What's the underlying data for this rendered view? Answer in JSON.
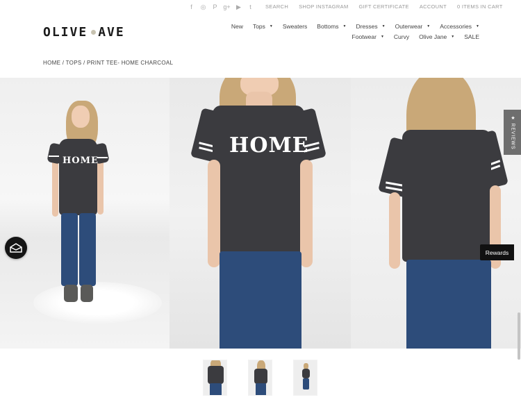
{
  "topbar": {
    "social_icons": [
      "facebook-icon",
      "instagram-icon",
      "pinterest-icon",
      "google-plus-icon",
      "youtube-icon",
      "twitter-icon"
    ],
    "social_glyphs": [
      "f",
      "◎",
      "P",
      "g+",
      "▶",
      "t"
    ],
    "links": [
      "SEARCH",
      "SHOP INSTAGRAM",
      "GIFT CERTIFICATE",
      "ACCOUNT",
      "0 ITEMS IN CART"
    ]
  },
  "logo": {
    "left": "OLIVE",
    "right": "AVE",
    "dot_color": "#c7c2b0"
  },
  "nav": {
    "row1": [
      {
        "label": "New",
        "dropdown": false
      },
      {
        "label": "Tops",
        "dropdown": true
      },
      {
        "label": "Sweaters",
        "dropdown": false
      },
      {
        "label": "Bottoms",
        "dropdown": true
      },
      {
        "label": "Dresses",
        "dropdown": true
      },
      {
        "label": "Outerwear",
        "dropdown": true
      },
      {
        "label": "Accessories",
        "dropdown": true
      }
    ],
    "row2": [
      {
        "label": "Footwear",
        "dropdown": true
      },
      {
        "label": "Curvy",
        "dropdown": false
      },
      {
        "label": "Olive Jane",
        "dropdown": true
      },
      {
        "label": "SALE",
        "dropdown": false
      }
    ]
  },
  "breadcrumb": "HOME / TOPS / PRINT TEE- HOME CHARCOAL",
  "product": {
    "shirt_print": "HOME",
    "tee_color": "#3b3b3f",
    "jeans_color": "#2d4c7a"
  },
  "side": {
    "reviews_label": "★ REVIEWS",
    "rewards_label": "Rewards"
  },
  "thumbnails": [
    "thumbnail-front-closeup",
    "thumbnail-back-view",
    "thumbnail-full-body"
  ]
}
